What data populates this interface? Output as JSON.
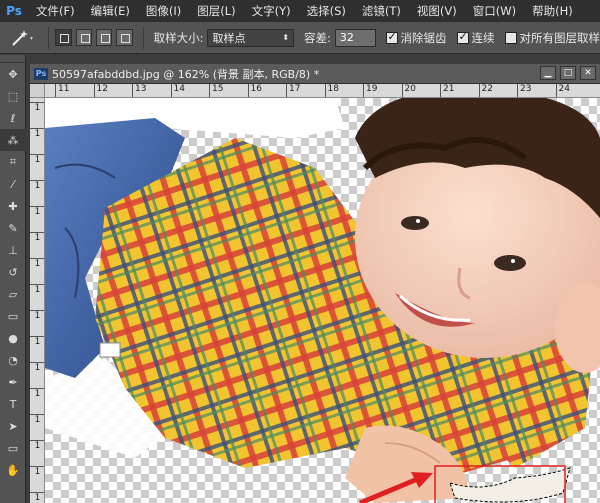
{
  "app": {
    "logo": "Ps"
  },
  "menu": [
    "文件(F)",
    "编辑(E)",
    "图像(I)",
    "图层(L)",
    "文字(Y)",
    "选择(S)",
    "滤镜(T)",
    "视图(V)",
    "窗口(W)",
    "帮助(H)"
  ],
  "options": {
    "sample_size_label": "取样大小:",
    "sample_size_value": "取样点",
    "tolerance_label": "容差:",
    "tolerance_value": "32",
    "antialias_label": "消除锯齿",
    "antialias_checked": true,
    "contiguous_label": "连续",
    "contiguous_checked": true,
    "sample_all_label": "对所有图层取样",
    "sample_all_checked": false
  },
  "document": {
    "tab_title": "50597afabddbd.jpg @ 162% (背景 副本, RGB/8) *",
    "ps_badge": "Ps",
    "ruler_h": [
      "11",
      "12",
      "13",
      "14",
      "15",
      "16",
      "17",
      "18",
      "19",
      "20",
      "21",
      "22",
      "23",
      "24"
    ],
    "ruler_v": [
      "1",
      "1",
      "1",
      "1",
      "1",
      "1",
      "1",
      "1",
      "1",
      "1",
      "1",
      "1",
      "1",
      "1",
      "1",
      "1"
    ]
  },
  "colors": {
    "annotation": "#e02020"
  },
  "icons": [
    "magic-wand-icon",
    "move-icon",
    "marquee-icon",
    "lasso-icon",
    "quick-select-icon",
    "crop-icon",
    "eyedropper-icon",
    "healing-icon",
    "brush-icon",
    "stamp-icon",
    "history-brush-icon",
    "eraser-icon",
    "gradient-icon",
    "blur-icon",
    "dodge-icon",
    "pen-icon",
    "type-icon",
    "path-select-icon",
    "shape-icon"
  ]
}
